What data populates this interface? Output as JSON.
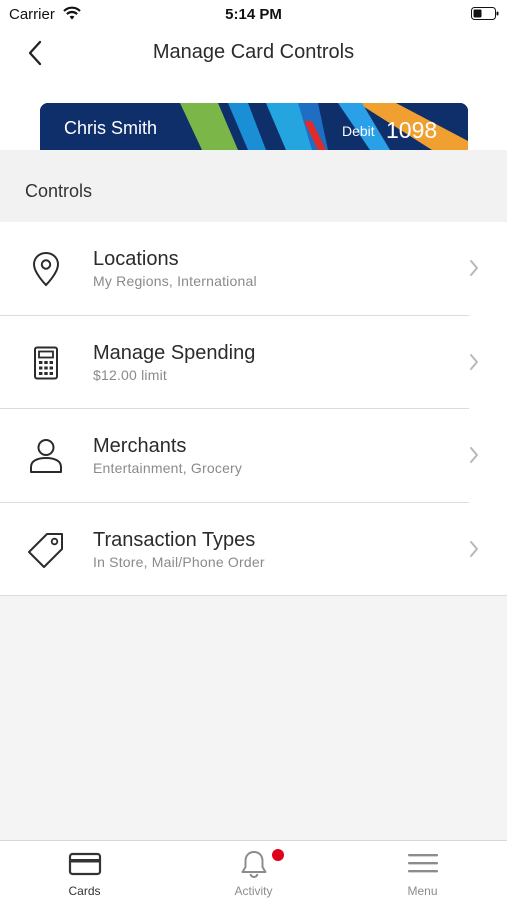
{
  "status_bar": {
    "carrier": "Carrier",
    "time": "5:14 PM"
  },
  "header": {
    "title": "Manage Card Controls",
    "back_icon": "chevron-left-icon"
  },
  "card": {
    "holder": "Chris Smith",
    "type": "Debit",
    "last4": "1098"
  },
  "controls": {
    "section_title": "Controls",
    "items": [
      {
        "title": "Locations",
        "subtitle": "My Regions, International",
        "icon": "location-pin-icon"
      },
      {
        "title": "Manage Spending",
        "subtitle": "$12.00 limit",
        "icon": "calculator-icon"
      },
      {
        "title": "Merchants",
        "subtitle": "Entertainment, Grocery",
        "icon": "person-icon"
      },
      {
        "title": "Transaction Types",
        "subtitle": "In Store, Mail/Phone Order",
        "icon": "tag-icon"
      }
    ]
  },
  "tab_bar": {
    "tabs": [
      {
        "label": "Cards",
        "icon": "card-icon",
        "active": true
      },
      {
        "label": "Activity",
        "icon": "bell-icon",
        "badge": true
      },
      {
        "label": "Menu",
        "icon": "menu-icon"
      }
    ]
  },
  "colors": {
    "badge": "#e0001b",
    "card_background": "#0f2f6a"
  }
}
